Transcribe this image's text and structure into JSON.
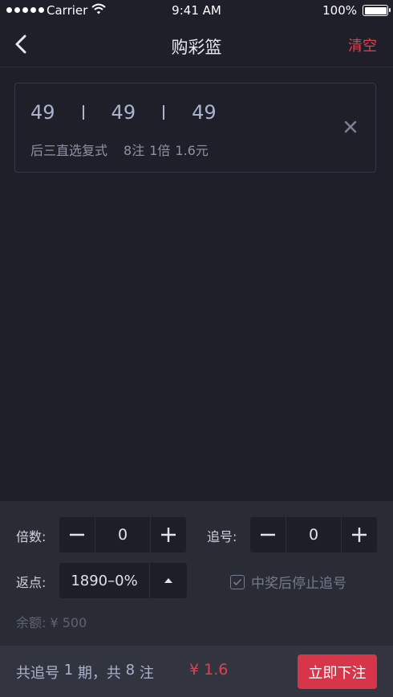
{
  "status_bar": {
    "carrier": "Carrier",
    "time": "9:41 AM",
    "battery": "100%"
  },
  "nav": {
    "title": "购彩篮",
    "clear_label": "清空"
  },
  "bet_item": {
    "numbers": [
      "49",
      "49",
      "49"
    ],
    "play_type": "后三直选复式",
    "count": "8注",
    "multiple": "1倍",
    "amount": "1.6元"
  },
  "settings": {
    "multiple_label": "倍数:",
    "multiple_value": "0",
    "chase_label": "追号:",
    "chase_value": "0",
    "rebate_label": "返点:",
    "rebate_value": "1890–0%",
    "stop_label": "中奖后停止追号",
    "balance_text": "余额: ¥ 500"
  },
  "footer": {
    "summary_prefix": "共追号 ",
    "periods": "1",
    "summary_mid": " 期，共 ",
    "bets": "8",
    "summary_suffix": " 注",
    "total": "¥ 1.6",
    "submit_label": "立即下注"
  },
  "colors": {
    "background": "#1e1f29",
    "accent_red": "#e2404f",
    "button_red": "#d7364a",
    "number_blue": "#a9b4cf"
  },
  "icons": [
    "back-icon",
    "wifi-icon",
    "close-icon",
    "minus-icon",
    "plus-icon",
    "caret-up-icon",
    "checkbox-icon"
  ]
}
